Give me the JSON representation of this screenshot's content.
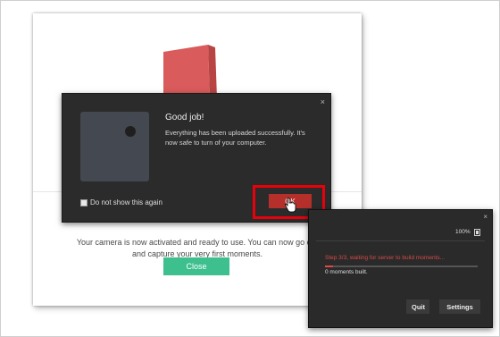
{
  "background_window": {
    "message_line1": "Your camera is now activated and ready to use. You can now go out",
    "message_line2": "and capture your very first moments.",
    "close_label": "Close"
  },
  "dialog": {
    "title": "Good job!",
    "message": "Everything has been uploaded successfully. It's now safe to turn of your computer.",
    "checkbox_label": "Do not show this again",
    "ok_label": "OK",
    "close_glyph": "×"
  },
  "status_panel": {
    "battery": "100%",
    "status": "Step 3/3, waiting for server to build moments...",
    "progress": 0.05,
    "moments": "0 moments built.",
    "quit_label": "Quit",
    "settings_label": "Settings",
    "close_glyph": "×"
  },
  "colors": {
    "accent_red": "#b5302b",
    "highlight_red": "#e8000b",
    "close_green": "#3dbf8e",
    "status_red": "#d94a4a"
  },
  "icons": [
    "device-illustration-icon",
    "close-icon",
    "cursor-hand-icon",
    "battery-icon"
  ]
}
